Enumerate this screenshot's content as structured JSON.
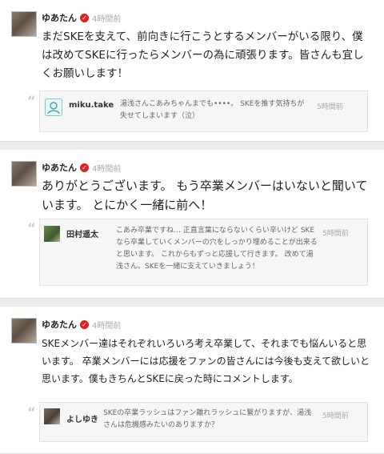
{
  "posts": [
    {
      "author": "ゆあたん",
      "time": "4時間前",
      "text": "まだSKEを支えて、前向きに行こうとするメンバーがいる限り、僕は改めてSKEに行ったらメンバーの為に頑張ります。皆さんも宜しくお願いします！",
      "reply": {
        "user": "miku.take",
        "text": "湯浅さんこあみちゃんまでも••••。 SKEを推す気持ちが失せてしまいます（泣）",
        "time": "5時間前"
      }
    },
    {
      "author": "ゆあたん",
      "time": "4時間前",
      "text": "ありがとうございます。 もう卒業メンバーはいないと聞いています。 とにかく一緒に前へ！",
      "reply": {
        "user": "田村遥太",
        "text": "こあみ卒業ですね… 正直言葉にならないくらい辛いけど SKEなら卒業していくメンバーの穴をしっかり埋めることが出来ると思います。 これからもずっと応援して行きます。 改めて湯浅さん。SKEを一緒に支えていきましょう！",
        "time": "5時間前"
      }
    },
    {
      "author": "ゆあたん",
      "time": "4時間前",
      "text": "SKEメンバー達はそれぞれいろいろ考え卒業して、それまでも悩んいると思います。 卒業メンバーには応援をファンの皆さんには今後も支えて欲しいと思います。僕もきちんとSKEに戻った時にコメントします。",
      "reply": {
        "user": "よしゆき",
        "text": "SKEの卒業ラッシュはファン離れラッシュに繋がりますが、湯浅さんは危機感みたいのありますか？",
        "time": "5時間前"
      }
    }
  ],
  "icons": {
    "verified": "verified-check-icon",
    "quote": "quote-icon"
  },
  "colors": {
    "verified": "#dd2222",
    "background": "#ececec"
  }
}
